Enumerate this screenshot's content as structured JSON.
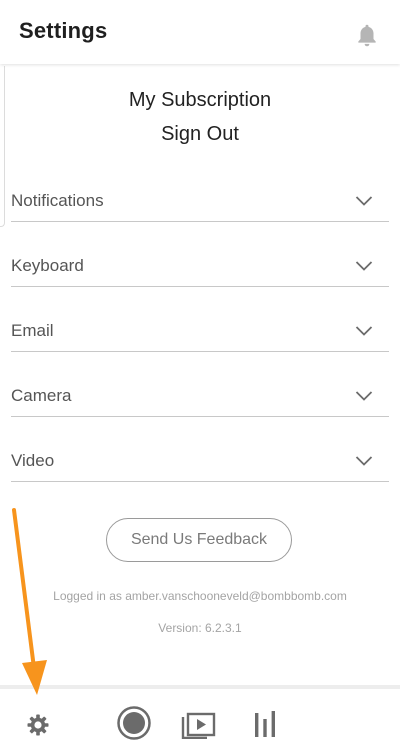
{
  "header": {
    "title": "Settings",
    "bell_icon": "bell-icon"
  },
  "top_links": {
    "subscription": "My Subscription",
    "sign_out": "Sign Out"
  },
  "sections": [
    {
      "label": "Notifications",
      "icon": "chevron-down-icon"
    },
    {
      "label": "Keyboard",
      "icon": "chevron-down-icon"
    },
    {
      "label": "Email",
      "icon": "chevron-down-icon"
    },
    {
      "label": "Camera",
      "icon": "chevron-down-icon"
    },
    {
      "label": "Video",
      "icon": "chevron-down-icon"
    }
  ],
  "feedback_label": "Send Us Feedback",
  "logged_in_text": "Logged in as amber.vanschooneveld@bombbomb.com",
  "version_text": "Version: 6.2.3.1",
  "tabbar": {
    "items": [
      {
        "name": "settings",
        "icon": "gear-icon"
      },
      {
        "name": "record",
        "icon": "record-icon"
      },
      {
        "name": "videos",
        "icon": "video-library-icon"
      },
      {
        "name": "analytics",
        "icon": "bar-chart-icon"
      }
    ]
  },
  "colors": {
    "annotation_arrow": "#f7941d",
    "divider": "#c8c8c8",
    "icon_gray": "#6b6b6b"
  }
}
